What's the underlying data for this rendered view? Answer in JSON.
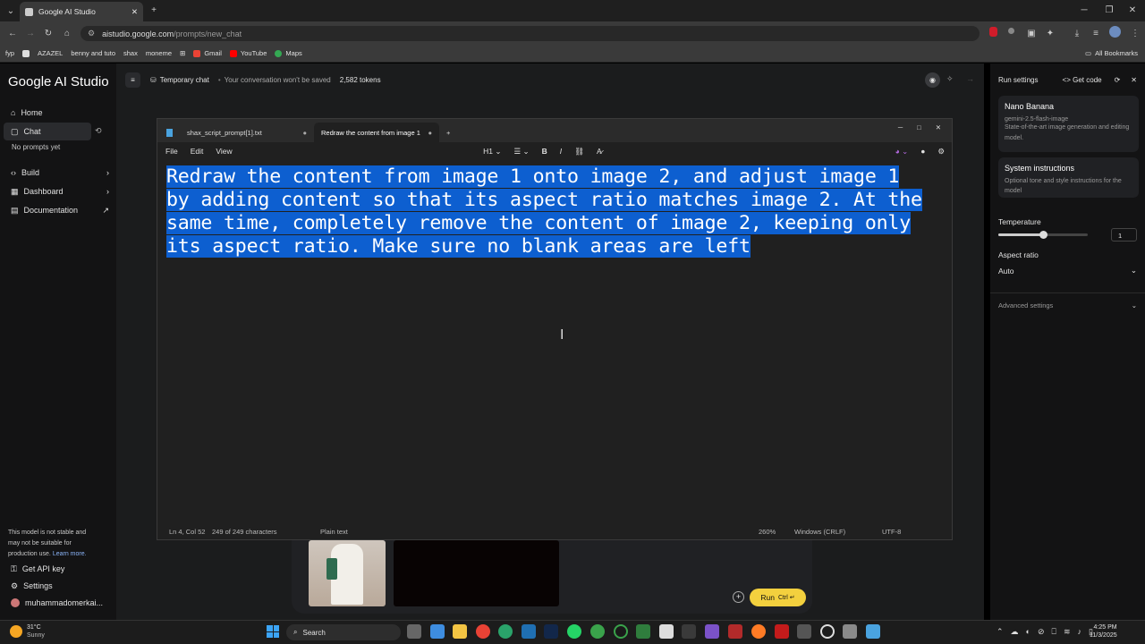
{
  "browser": {
    "tab_title": "Google AI Studio",
    "url_domain": "aistudio.google.com",
    "url_path": "/prompts/new_chat",
    "bookmarks": [
      "fyp",
      "AZAZEL",
      "benny and tuto",
      "shax",
      "moneme",
      "Gmail",
      "YouTube",
      "Maps"
    ],
    "all_bookmarks": "All Bookmarks"
  },
  "studio": {
    "logo": "Google AI Studio",
    "nav": {
      "home": "Home",
      "chat": "Chat",
      "no_prompts": "No prompts yet",
      "build": "Build",
      "dashboard": "Dashboard",
      "documentation": "Documentation"
    },
    "footer_note": "This model is not stable and may not be suitable for production use.",
    "learn_more": "Learn more.",
    "api_key": "Get API key",
    "settings": "Settings",
    "account": "muhammadomerkai...",
    "topbar": {
      "temp_chat": "Temporary chat",
      "not_saved": "Your conversation won't be saved",
      "tokens": "2,582 tokens"
    },
    "run_label": "Run",
    "run_shortcut": "Ctrl ↵"
  },
  "run_settings": {
    "title": "Run settings",
    "get_code": "Get code",
    "model_name": "Nano Banana",
    "model_id": "gemini-2.5-flash-image",
    "model_desc": "State-of-the-art image generation and editing model.",
    "sys_title": "System instructions",
    "sys_desc": "Optional tone and style instructions for the model",
    "temperature_label": "Temperature",
    "temperature_value": "1",
    "temperature_fraction": 0.5,
    "aspect_label": "Aspect ratio",
    "aspect_value": "Auto",
    "advanced": "Advanced settings"
  },
  "notepad": {
    "tab1": "shax_script_prompt[1].txt",
    "tab2": "Redraw the content from image 1 c",
    "menu": {
      "file": "File",
      "edit": "Edit",
      "view": "View",
      "heading": "H1"
    },
    "lines": [
      "Redraw the content from image 1 onto image 2, and adjust image 1",
      "by adding content so that its aspect ratio matches image 2. At the",
      "same time, completely remove the content of image 2, keeping only",
      "its aspect ratio. Make sure no blank areas are left"
    ],
    "status": {
      "position": "Ln 4, Col 52",
      "chars": "249 of 249 characters",
      "format": "Plain text",
      "zoom": "260%",
      "line_ending": "Windows (CRLF)",
      "encoding": "UTF-8"
    }
  },
  "taskbar": {
    "temp": "31°C",
    "weather": "Sunny",
    "search": "Search",
    "time": "4:25 PM",
    "date": "11/3/2025"
  },
  "colors": {
    "run_button": "#f3d03e",
    "selection": "#0d5fd0"
  }
}
